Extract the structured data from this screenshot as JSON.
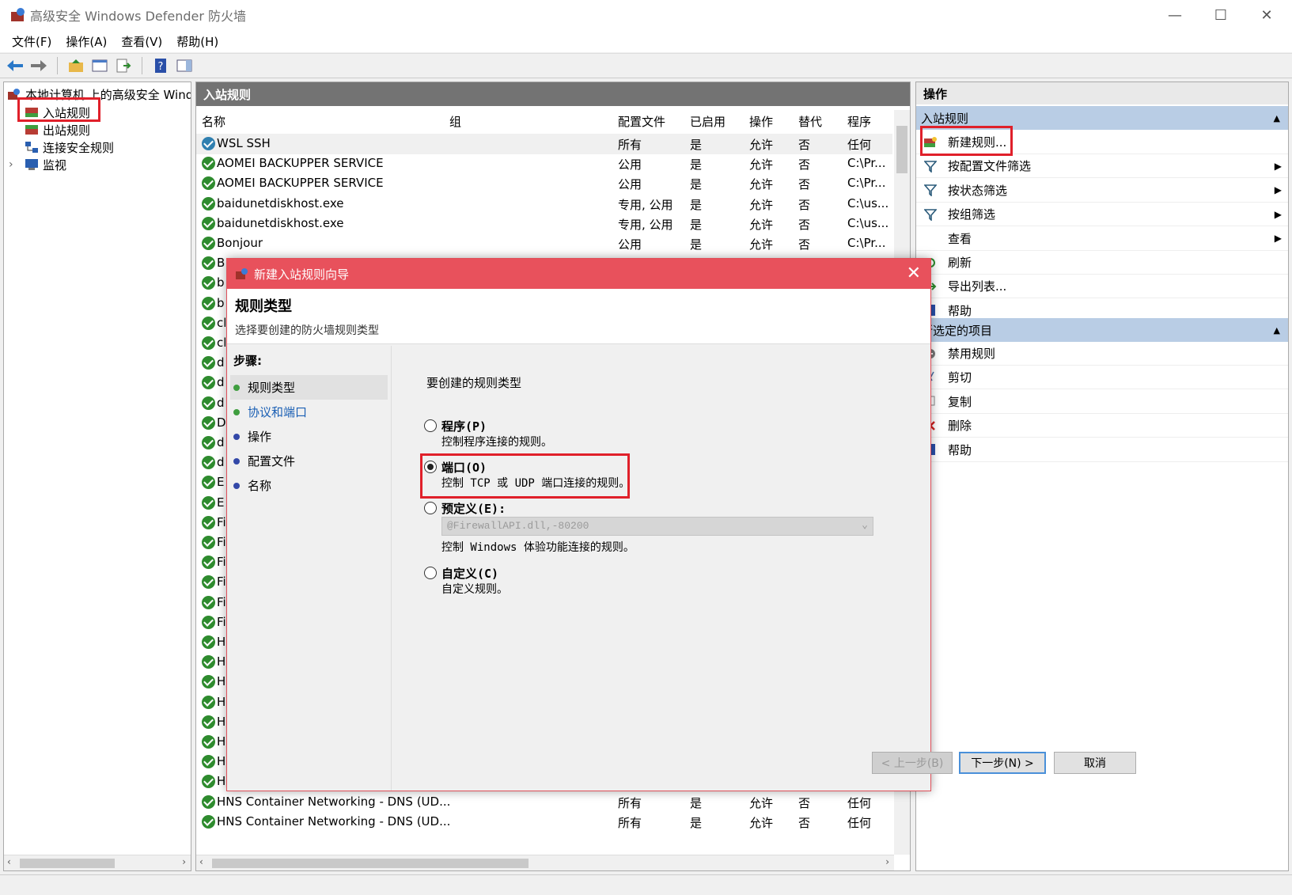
{
  "window": {
    "title": "高级安全 Windows Defender 防火墙",
    "minimize": "—",
    "maximize": "☐",
    "close": "✕"
  },
  "menu": [
    "文件(F)",
    "操作(A)",
    "查看(V)",
    "帮助(H)"
  ],
  "tree": {
    "root": "本地计算机 上的高级安全 Windows Defender 防火墙",
    "items": [
      "入站规则",
      "出站规则",
      "连接安全规则",
      "监视"
    ],
    "expander": "›"
  },
  "middle": {
    "header": "入站规则",
    "columns": [
      "名称",
      "组",
      "配置文件",
      "已启用",
      "操作",
      "替代",
      "程序"
    ],
    "rows": [
      {
        "name": "WSL SSH",
        "profile": "所有",
        "enabled": "是",
        "action": "允许",
        "override": "否",
        "program": "任何"
      },
      {
        "name": "AOMEI BACKUPPER SERVICE",
        "profile": "公用",
        "enabled": "是",
        "action": "允许",
        "override": "否",
        "program": "C:\\Pr..."
      },
      {
        "name": "AOMEI BACKUPPER SERVICE",
        "profile": "公用",
        "enabled": "是",
        "action": "允许",
        "override": "否",
        "program": "C:\\Pr..."
      },
      {
        "name": "baidunetdiskhost.exe",
        "profile": "专用, 公用",
        "enabled": "是",
        "action": "允许",
        "override": "否",
        "program": "C:\\us..."
      },
      {
        "name": "baidunetdiskhost.exe",
        "profile": "专用, 公用",
        "enabled": "是",
        "action": "允许",
        "override": "否",
        "program": "C:\\us..."
      },
      {
        "name": "Bonjour",
        "profile": "公用",
        "enabled": "是",
        "action": "允许",
        "override": "否",
        "program": "C:\\Pr..."
      }
    ],
    "hidden_rows": [
      "B",
      "b",
      "b",
      "cl",
      "cl",
      "d",
      "d",
      "d",
      "D",
      "d",
      "d",
      "E",
      "E",
      "Fi",
      "Fi",
      "Fi",
      "Fi",
      "Fi",
      "Fi",
      "H",
      "H",
      "H",
      "H",
      "H",
      "H",
      "H"
    ],
    "bottom_rows": [
      {
        "name": "HNS Container Networking - DNS (UD...",
        "profile": "所有",
        "enabled": "是",
        "action": "允许",
        "override": "否",
        "program": "任何"
      },
      {
        "name": "HNS Container Networking - DNS (UD...",
        "profile": "所有",
        "enabled": "是",
        "action": "允许",
        "override": "否",
        "program": "任何"
      },
      {
        "name": "HNS Container Networking - DNS (UD...",
        "profile": "所有",
        "enabled": "是",
        "action": "允许",
        "override": "否",
        "program": "任何"
      }
    ]
  },
  "actions": {
    "header": "操作",
    "section1": "入站规则",
    "items1": [
      {
        "label": "新建规则...",
        "icon": "new-rule-icon",
        "submenu": ""
      },
      {
        "label": "按配置文件筛选",
        "icon": "filter-icon",
        "submenu": "▶"
      },
      {
        "label": "按状态筛选",
        "icon": "filter-icon",
        "submenu": "▶"
      },
      {
        "label": "按组筛选",
        "icon": "filter-icon",
        "submenu": "▶"
      },
      {
        "label": "查看",
        "icon": "",
        "submenu": "▶"
      },
      {
        "label": "刷新",
        "icon": "refresh-icon",
        "submenu": ""
      },
      {
        "label": "导出列表...",
        "icon": "export-icon",
        "submenu": ""
      },
      {
        "label": "帮助",
        "icon": "help-icon",
        "submenu": ""
      }
    ],
    "section2": "所选定的项目",
    "items2": [
      {
        "label": "禁用规则",
        "icon": "disable-icon"
      },
      {
        "label": "剪切",
        "icon": "cut-icon"
      },
      {
        "label": "复制",
        "icon": "copy-icon"
      },
      {
        "label": "删除",
        "icon": "delete-icon"
      },
      {
        "label": "帮助",
        "icon": "help-icon"
      }
    ]
  },
  "dialog": {
    "title": "新建入站规则向导",
    "close": "✕",
    "heading": "规则类型",
    "subheading": "选择要创建的防火墙规则类型",
    "steps_label": "步骤:",
    "steps": [
      "规则类型",
      "协议和端口",
      "操作",
      "配置文件",
      "名称"
    ],
    "prompt": "要创建的规则类型",
    "options": [
      {
        "title": "程序(P)",
        "desc": "控制程序连接的规则。",
        "selected": false
      },
      {
        "title": "端口(O)",
        "desc": "控制 TCP 或 UDP 端口连接的规则。",
        "selected": true
      },
      {
        "title": "预定义(E):",
        "desc": "控制 Windows 体验功能连接的规则。",
        "selected": false
      },
      {
        "title": "自定义(C)",
        "desc": "自定义规则。",
        "selected": false
      }
    ],
    "predefined_value": "@FirewallAPI.dll,-80200",
    "buttons": {
      "back": "< 上一步(B)",
      "next": "下一步(N) >",
      "cancel": "取消"
    }
  },
  "colors": {
    "accent_red": "#e0202a",
    "dialog_title": "#e8515c",
    "section_blue": "#b9cde5",
    "check_green": "#2e8b2e"
  }
}
